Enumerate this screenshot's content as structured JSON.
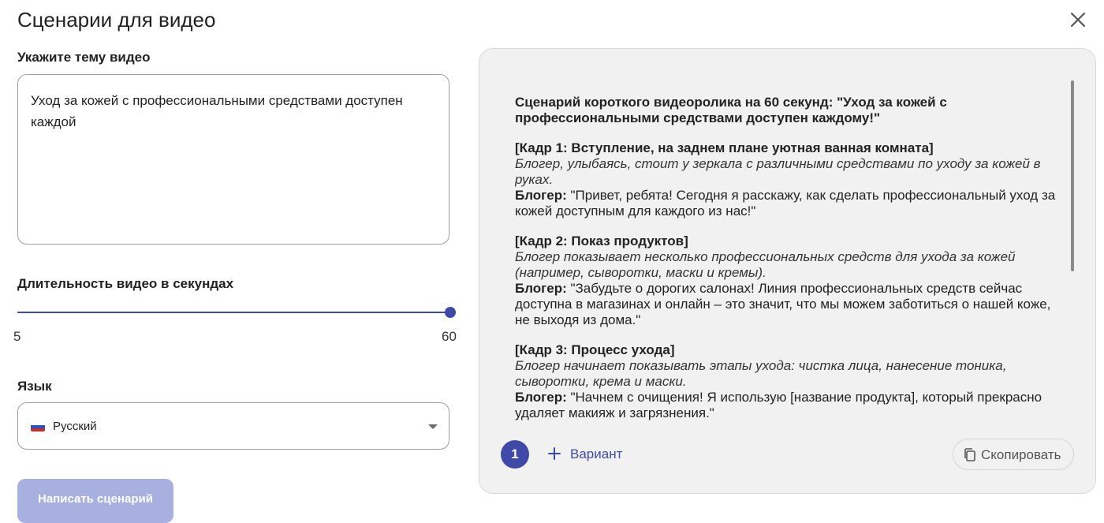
{
  "dialog": {
    "title": "Сценарии для видео"
  },
  "topic": {
    "label": "Укажите тему видео",
    "value": "Уход за кожей с профессиональными средствами доступен каждой"
  },
  "duration": {
    "label": "Длительность видео в секундах",
    "min": "5",
    "max": "60",
    "value": 60
  },
  "language": {
    "label": "Язык",
    "selected": "Русский",
    "flag_colors": [
      "#ffffff",
      "#1c56d4",
      "#d52b1e"
    ]
  },
  "submit_label": "Написать сценарий",
  "result": {
    "heading": "Сценарий короткого видеоролика на 60 секунд: \"Уход за кожей с профессиональными средствами доступен каждому!\"",
    "scenes": [
      {
        "title": "[Кадр 1: Вступление, на заднем плане уютная ванная комната]",
        "direction": "Блогер, улыбаясь, стоит у зеркала с различными средствами по уходу за кожей в руках.",
        "speaker": "Блогер:",
        "line": "\"Привет, ребята! Сегодня я расскажу, как сделать профессиональный уход за кожей доступным для каждого из нас!\""
      },
      {
        "title": "[Кадр 2: Показ продуктов]",
        "direction": "Блогер показывает несколько профессиональных средств для ухода за кожей (например, сыворотки, маски и кремы).",
        "speaker": "Блогер:",
        "line": "\"Забудьте о дорогих салонах! Линия профессиональных средств сейчас доступна в магазинах и онлайн – это значит, что мы можем заботиться о нашей коже, не выходя из дома.\""
      },
      {
        "title": "[Кадр 3: Процесс ухода]",
        "direction": "Блогер начинает показывать этапы ухода: чистка лица, нанесение тоника, сыворотки, крема и маски.",
        "speaker": "Блогер:",
        "line": "\"Начнем с очищения! Я использую [название продукта], который прекрасно удаляет макияж и загрязнения.\""
      }
    ],
    "variant_number": "1",
    "add_variant_label": "Вариант",
    "copy_label": "Скопировать"
  },
  "colors": {
    "accent": "#3f4aa8",
    "submit_disabled": "#a8b0e0",
    "panel_bg": "#f1f1f1"
  },
  "icons": {
    "close": "close-icon",
    "plus": "plus-icon",
    "copy": "copy-icon",
    "dropdown": "chevron-down-icon"
  }
}
